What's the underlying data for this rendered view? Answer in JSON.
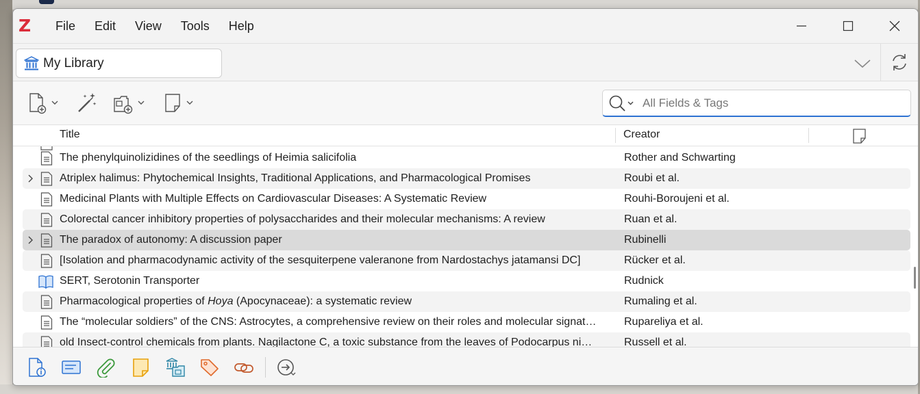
{
  "window": {
    "menu": [
      "File",
      "Edit",
      "View",
      "Tools",
      "Help"
    ]
  },
  "library": {
    "name": "My Library"
  },
  "search": {
    "placeholder": "All Fields & Tags",
    "value": ""
  },
  "columns": {
    "title": "Title",
    "creator": "Creator"
  },
  "items": [
    {
      "title": "The phenylquinolizidines of the seedlings of Heimia salicifolia",
      "creator": "Rother and Schwarting",
      "type": "document",
      "expandable": false
    },
    {
      "title": "Atriplex halimus: Phytochemical Insights, Traditional Applications, and Pharmacological Promises",
      "creator": "Roubi et al.",
      "type": "document",
      "expandable": true
    },
    {
      "title": "Medicinal Plants with Multiple Effects on Cardiovascular Diseases: A Systematic Review",
      "creator": "Rouhi-Boroujeni et al.",
      "type": "document",
      "expandable": false
    },
    {
      "title": "Colorectal cancer inhibitory properties of polysaccharides and their molecular mechanisms: A review",
      "creator": "Ruan et al.",
      "type": "document",
      "expandable": false
    },
    {
      "title": "The paradox of autonomy: A discussion paper",
      "creator": "Rubinelli",
      "type": "document",
      "expandable": true,
      "selected": true
    },
    {
      "title": "[Isolation and pharmacodynamic activity of the sesquiterpene valeranone from Nardostachys jatamansi DC]",
      "creator": "Rücker et al.",
      "type": "document",
      "expandable": false
    },
    {
      "title": "SERT, Serotonin Transporter",
      "creator": "Rudnick",
      "type": "book",
      "expandable": false
    },
    {
      "title_pre": "Pharmacological properties of ",
      "title_em": "Hoya",
      "title_post": " (Apocynaceae): a systematic review",
      "creator": "Rumaling et al.",
      "type": "document",
      "expandable": false
    },
    {
      "title": "The “molecular soldiers” of the CNS: Astrocytes, a comprehensive review on their roles and molecular signat…",
      "creator": "Rupareliya et al.",
      "type": "document",
      "expandable": false
    },
    {
      "title": "old Insect-control chemicals from plants. Nagilactone C, a toxic substance from the leaves of Podocarpus ni…",
      "creator": "Russell et al.",
      "type": "document",
      "expandable": false
    }
  ],
  "bottom_icons": [
    "item-info-icon",
    "abstract-icon",
    "attachment-icon",
    "note-icon",
    "libraries-collections-icon",
    "tag-icon",
    "related-icon",
    "locate-icon"
  ],
  "colors": {
    "brand": "#db2c3a",
    "accent": "#2d72d2",
    "selected_row": "#dadada"
  }
}
